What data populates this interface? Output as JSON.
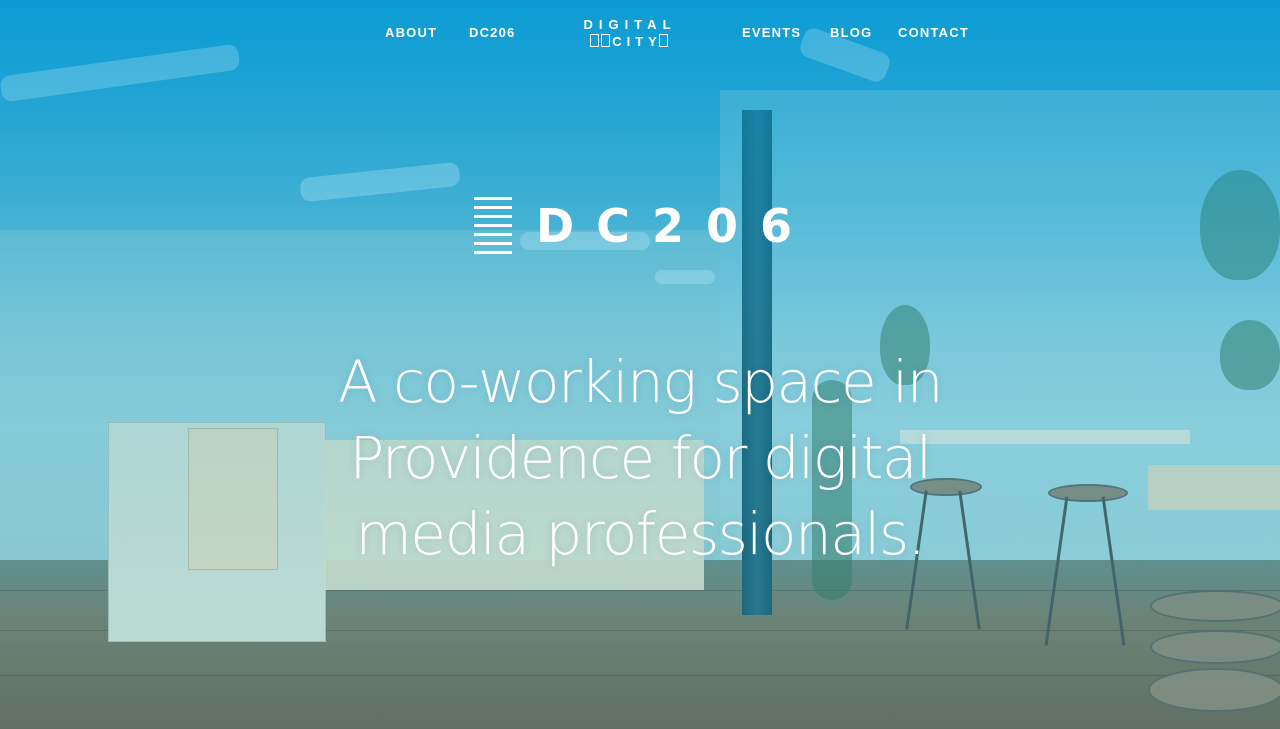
{
  "nav": {
    "about": "ABOUT",
    "dc206": "DC206",
    "logo_line1": "DIGITAL",
    "logo_line2": "CITY",
    "events": "EVENTS",
    "blog": "BLOG",
    "contact": "CONTACT"
  },
  "hero": {
    "brand": "DC206",
    "headline": "A co-working space in Providence for digital media professionals."
  },
  "colors": {
    "overlay": "#0096d2",
    "text": "#ffffff"
  },
  "icons": {
    "brand_icon": "stacked-bars-icon",
    "logo_boxes": "square-outline-icon"
  }
}
